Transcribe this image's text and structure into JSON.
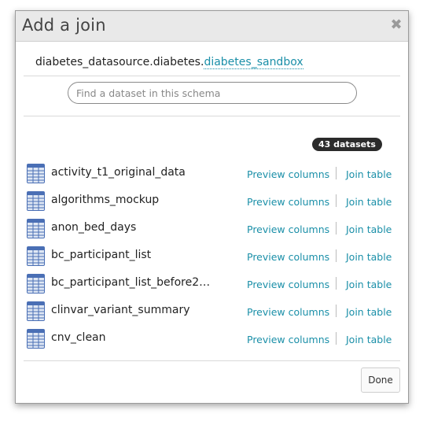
{
  "dialog": {
    "title": "Add a join",
    "close_icon": "close-icon"
  },
  "schema": {
    "prefix": "diabetes_datasource.diabetes.",
    "link": "diabetes_sandbox"
  },
  "search": {
    "placeholder": "Find a dataset in this schema",
    "value": ""
  },
  "count_label": "43 datasets",
  "datasets": [
    {
      "name": "activity_t1_original_data",
      "preview": "Preview columns",
      "join": "Join table"
    },
    {
      "name": "algorithms_mockup",
      "preview": "Preview columns",
      "join": "Join table"
    },
    {
      "name": "anon_bed_days",
      "preview": "Preview columns",
      "join": "Join table"
    },
    {
      "name": "bc_participant_list",
      "preview": "Preview columns",
      "join": "Join table"
    },
    {
      "name": "bc_participant_list_before2…",
      "preview": "Preview columns",
      "join": "Join table"
    },
    {
      "name": "clinvar_variant_summary",
      "preview": "Preview columns",
      "join": "Join table"
    },
    {
      "name": "cnv_clean",
      "preview": "Preview columns",
      "join": "Join table"
    }
  ],
  "footer": {
    "done_label": "Done"
  },
  "colors": {
    "link": "#1a8fa8",
    "icon_blue": "#4a6fb5"
  }
}
